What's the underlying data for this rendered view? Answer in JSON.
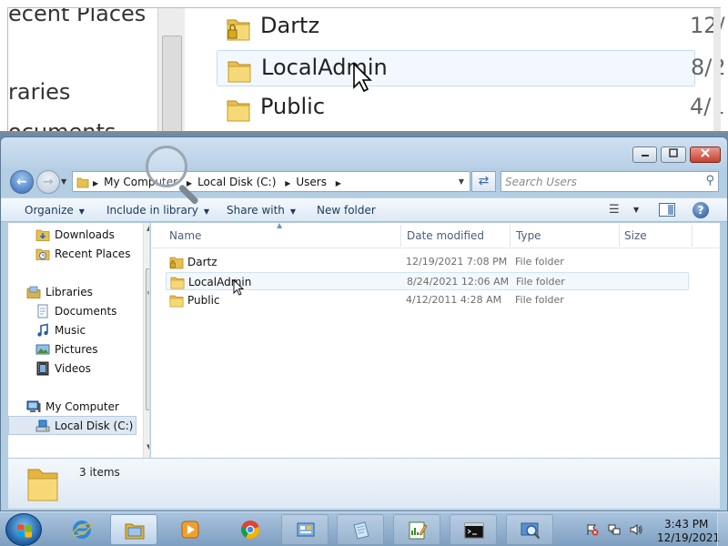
{
  "zoom": {
    "sidebar": [
      "ecent Places",
      "raries",
      "ocuments"
    ],
    "rows": [
      {
        "name": "Dartz",
        "date": "12/"
      },
      {
        "name": "LocalAdmin",
        "date": "8/2"
      },
      {
        "name": "Public",
        "date": "4/1"
      }
    ]
  },
  "window": {
    "address": {
      "crumbs": [
        "My Computer",
        "Local Disk (C:)",
        "Users"
      ]
    },
    "search": {
      "placeholder": "Search Users"
    },
    "toolbar": {
      "organize": "Organize",
      "include": "Include in library",
      "share": "Share with",
      "new_folder": "New folder"
    },
    "nav": {
      "downloads": "Downloads",
      "recent": "Recent Places",
      "libraries": "Libraries",
      "documents": "Documents",
      "music": "Music",
      "pictures": "Pictures",
      "videos": "Videos",
      "computer": "My Computer",
      "localdisk": "Local Disk (C:)"
    },
    "columns": {
      "name": "Name",
      "date": "Date modified",
      "type": "Type",
      "size": "Size"
    },
    "files": [
      {
        "name": "Dartz",
        "date": "12/19/2021 7:08 PM",
        "type": "File folder",
        "locked": true
      },
      {
        "name": "LocalAdmin",
        "date": "8/24/2021 12:06 AM",
        "type": "File folder",
        "locked": false
      },
      {
        "name": "Public",
        "date": "4/12/2011 4:28 AM",
        "type": "File folder",
        "locked": false
      }
    ],
    "status": {
      "count": "3 items"
    }
  },
  "taskbar": {
    "clock_time": "3:43 PM",
    "clock_date": "12/19/2021"
  },
  "colors": {
    "titlebar": "#b8d0e6",
    "selection": "#f3f8fd",
    "taskbar": "#7e9fc0",
    "close_button": "#c7402f"
  }
}
